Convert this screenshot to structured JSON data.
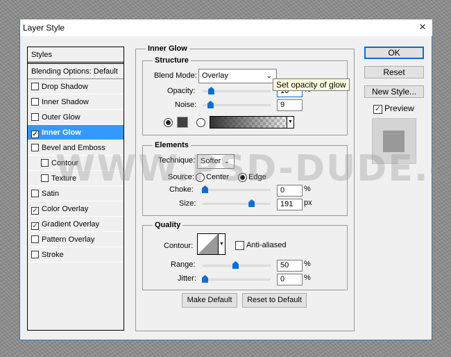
{
  "window": {
    "title": "Layer Style",
    "close": "×"
  },
  "styles_list": {
    "header": "Styles",
    "blending": "Blending Options: Default",
    "items": [
      {
        "label": "Drop Shadow",
        "checked": false
      },
      {
        "label": "Inner Shadow",
        "checked": false
      },
      {
        "label": "Outer Glow",
        "checked": false
      },
      {
        "label": "Inner Glow",
        "checked": true,
        "selected": true
      },
      {
        "label": "Bevel and Emboss",
        "checked": false
      },
      {
        "label": "Contour",
        "checked": false,
        "indent": true
      },
      {
        "label": "Texture",
        "checked": false,
        "indent": true
      },
      {
        "label": "Satin",
        "checked": false
      },
      {
        "label": "Color Overlay",
        "checked": true
      },
      {
        "label": "Gradient Overlay",
        "checked": true
      },
      {
        "label": "Pattern Overlay",
        "checked": false
      },
      {
        "label": "Stroke",
        "checked": false
      }
    ]
  },
  "panel": {
    "title": "Inner Glow",
    "structure": {
      "title": "Structure",
      "blend_mode_label": "Blend Mode:",
      "blend_mode": "Overlay",
      "opacity_label": "Opacity:",
      "opacity": "10",
      "opacity_unit": "%",
      "noise_label": "Noise:",
      "noise": "9",
      "color_mode": "solid",
      "color": "#404040"
    },
    "elements": {
      "title": "Elements",
      "technique_label": "Technique:",
      "technique": "Softer",
      "source_label": "Source:",
      "source_center": "Center",
      "source_edge": "Edge",
      "source": "edge",
      "choke_label": "Choke:",
      "choke": "0",
      "choke_unit": "%",
      "size_label": "Size:",
      "size": "191",
      "size_unit": "px"
    },
    "quality": {
      "title": "Quality",
      "contour_label": "Contour:",
      "anti_aliased_label": "Anti-aliased",
      "anti_aliased": false,
      "range_label": "Range:",
      "range": "50",
      "range_unit": "%",
      "jitter_label": "Jitter:",
      "jitter": "0",
      "jitter_unit": "%"
    },
    "make_default": "Make Default",
    "reset_default": "Reset to Default"
  },
  "buttons": {
    "ok": "OK",
    "reset": "Reset",
    "new_style": "New Style...",
    "preview_label": "Preview",
    "preview": true
  },
  "tooltip": "Set opacity of glow",
  "watermark": "WWW.PSD-DUDE.com",
  "colors": {
    "accent": "#3399ff",
    "slider": "#0a6fd6",
    "dialog_border": "#2b7bd0"
  }
}
